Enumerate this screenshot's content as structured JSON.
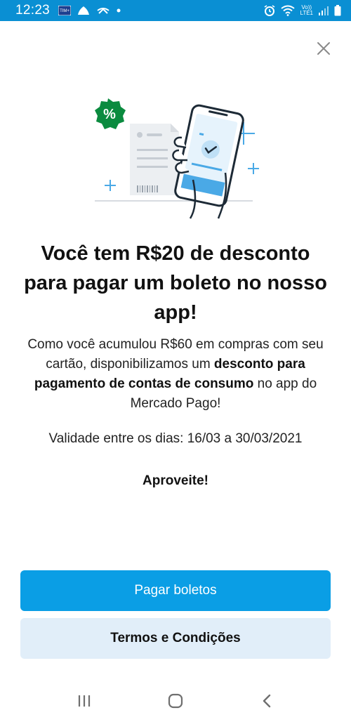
{
  "status_bar": {
    "time": "12:23",
    "carrier_badge": "TIM+",
    "volte_top": "Vo))",
    "volte_bottom": "LTE1",
    "colors": {
      "background": "#0a8fd3"
    }
  },
  "illustration": {
    "percent_badge": "%"
  },
  "title": "Você tem R$20 de desconto para pagar um boleto no nosso app!",
  "description": {
    "part1": "Como você acumulou R$60 em compras com seu cartão, disponibilizamos um ",
    "bold": "desconto para pagamento de contas de consumo",
    "part2": " no app do Mercado Pago!"
  },
  "validity": "Validade entre os dias: 16/03 a 30/03/2021",
  "cheer": "Aproveite!",
  "buttons": {
    "primary": "Pagar boletos",
    "secondary": "Termos e Condições"
  },
  "colors": {
    "primary_button": "#0a9ee5",
    "secondary_button": "#e1eef9",
    "badge_green": "#0b8b3f",
    "accent_blue": "#3aa3e3"
  },
  "icons": {
    "close": "close-icon",
    "nav_recents": "recents-icon",
    "nav_home": "home-icon",
    "nav_back": "back-icon"
  }
}
